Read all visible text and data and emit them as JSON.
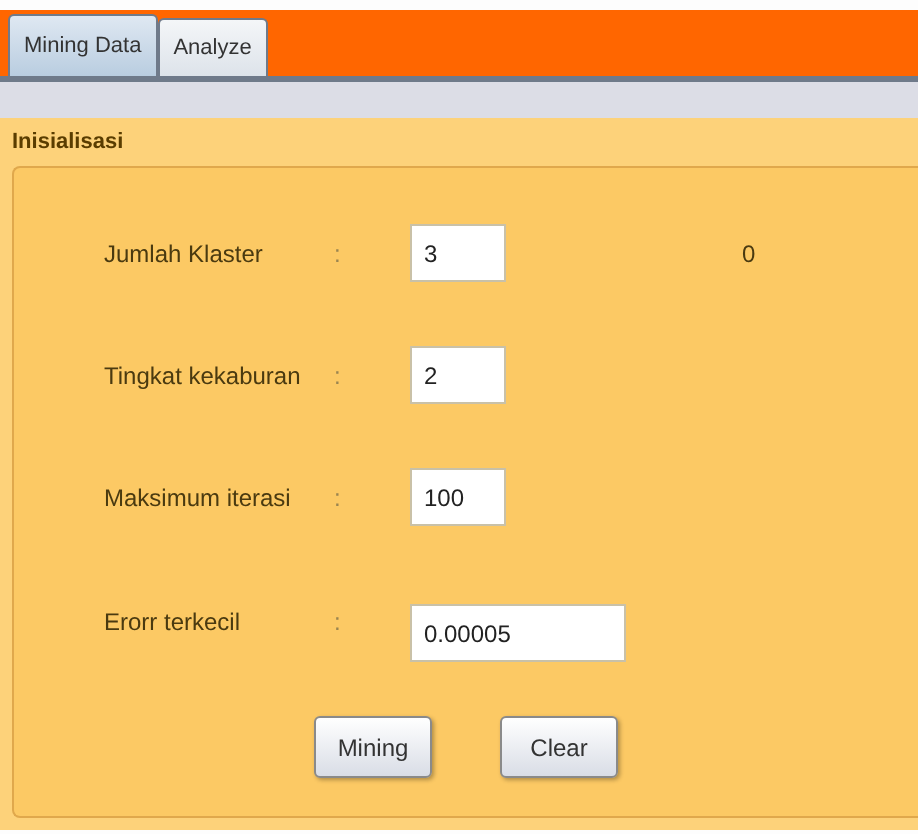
{
  "tabs": [
    {
      "label": "Mining Data",
      "selected": true
    },
    {
      "label": "Analyze",
      "selected": false
    }
  ],
  "panel": {
    "title": "Inisialisasi",
    "readout": "0",
    "fields": [
      {
        "label": "Jumlah Klaster",
        "separator": ":",
        "value": "3"
      },
      {
        "label": "Tingkat kekaburan",
        "separator": ":",
        "value": "2"
      },
      {
        "label": "Maksimum iterasi",
        "separator": ":",
        "value": "100"
      },
      {
        "label": "Erorr terkecil",
        "separator": ":",
        "value": "0.00005"
      }
    ],
    "buttons": [
      "Mining",
      "Clear"
    ]
  }
}
